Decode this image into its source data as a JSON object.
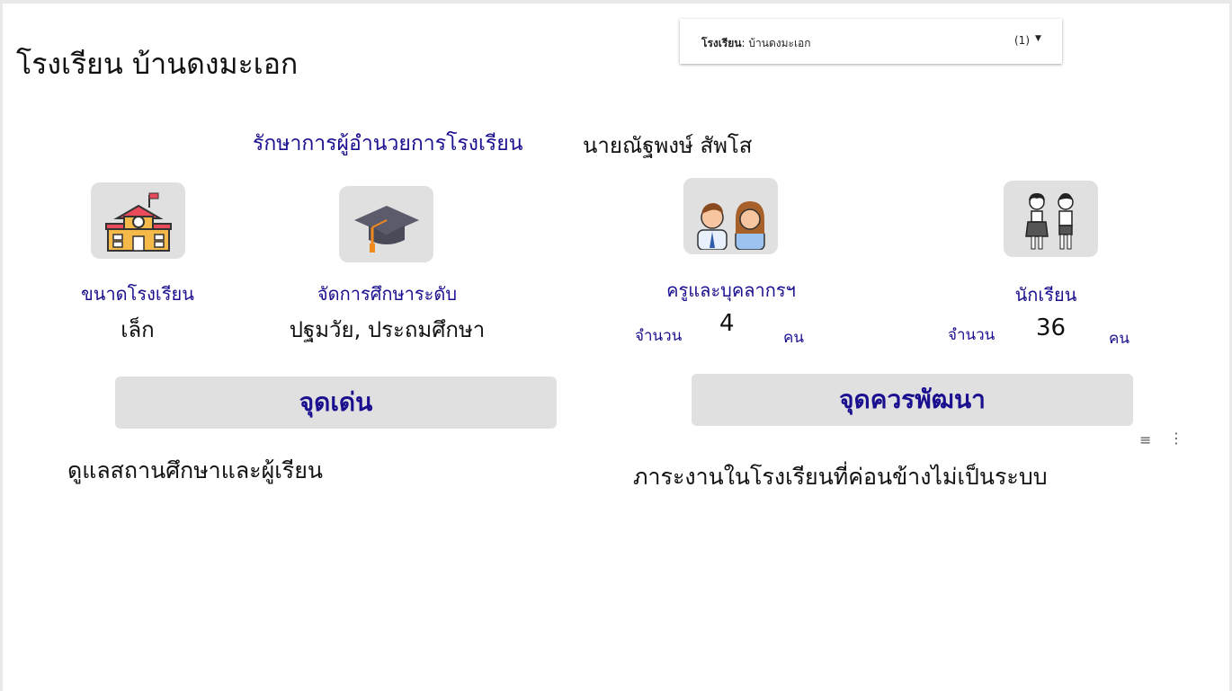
{
  "page": {
    "title": "โรงเรียน บ้านดงมะเอก"
  },
  "filter": {
    "label": "โรงเรียน",
    "value": "บ้านดงมะเอก",
    "count": "(1)"
  },
  "director": {
    "label": "รักษาการผู้อำนวยการโรงเรียน",
    "name": "นายณัฐพงษ์ สัพโส"
  },
  "school_size": {
    "label": "ขนาดโรงเรียน",
    "value": "เล็ก",
    "icon": "school-building-icon"
  },
  "education_level": {
    "label": "จัดการศึกษาระดับ",
    "value": "ปฐมวัย, ประถมศึกษา",
    "icon": "graduation-cap-icon"
  },
  "teachers": {
    "label": "ครูและบุคลากรฯ",
    "count_prefix": "จำนวน",
    "count": "4",
    "unit": "คน",
    "icon": "teachers-icon"
  },
  "students": {
    "label": "นักเรียน",
    "count_prefix": "จำนวน",
    "count": "36",
    "unit": "คน",
    "icon": "students-icon"
  },
  "strengths": {
    "heading": "จุดเด่น",
    "text": "ดูแลสถานศึกษาและผู้เรียน"
  },
  "improvements": {
    "heading": "จุดควรพัฒนา",
    "text": "ภาระงานในโรงเรียนที่ค่อนข้างไม่เป็นระบบ"
  },
  "colors": {
    "accent": "#1a0f8f",
    "panel": "#e0e0e0"
  }
}
